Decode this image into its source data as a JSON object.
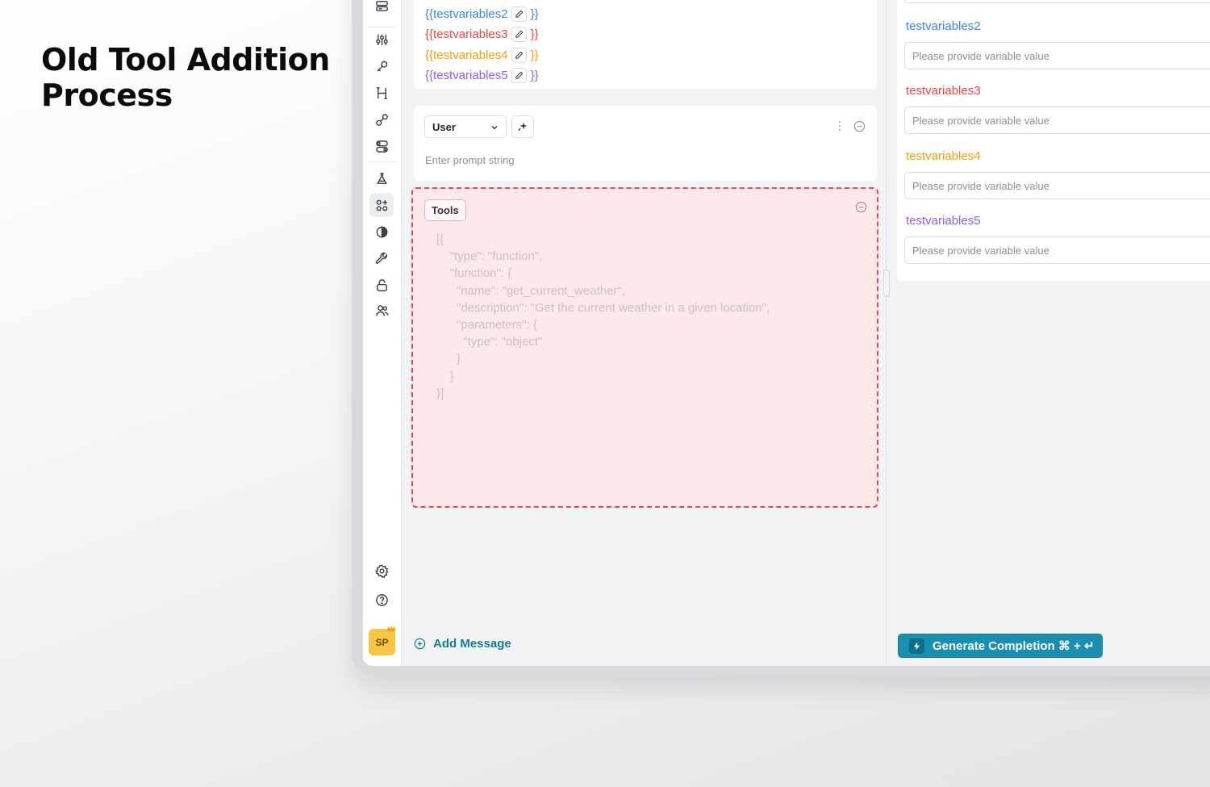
{
  "headline": {
    "line1": "Old Tool Addition",
    "line2": "Process"
  },
  "variables": [
    {
      "open": "{{",
      "name": "testvariables2",
      "close": "}}",
      "color": "#3b82f6"
    },
    {
      "open": "{{",
      "name": "testvariables3",
      "close": "}}",
      "color": "#ef4444"
    },
    {
      "open": "{{",
      "name": "testvariables4",
      "close": "}}",
      "color": "#f59e0b"
    },
    {
      "open": "{{",
      "name": "testvariables5",
      "close": "}}",
      "color": "#8b5cf6"
    }
  ],
  "message": {
    "role": "User",
    "placeholder": "Enter prompt string"
  },
  "tools": {
    "label": "Tools",
    "highlight_color": "#e8474f",
    "code": "[{\n    \"type\": \"function\",\n    \"function\": {\n      \"name\": \"get_current_weather\",\n      \"description\": \"Get the current weather in a given location\",\n      \"parameters\": {\n        \"type\": \"object\"\n      }\n    }\n}]"
  },
  "add_message": "Add Message",
  "right_panel": {
    "variables": [
      {
        "label": "testvariables2",
        "placeholder": "Please provide variable value",
        "color": "#3b82f6"
      },
      {
        "label": "testvariables3",
        "placeholder": "Please provide variable value",
        "color": "#ef4444"
      },
      {
        "label": "testvariables4",
        "placeholder": "Please provide variable value",
        "color": "#f59e0b"
      },
      {
        "label": "testvariables5",
        "placeholder": "Please provide variable value",
        "color": "#8b5cf6"
      }
    ]
  },
  "generate_button": "Generate Completion ⌘ + ↵",
  "user": {
    "initials": "SP"
  },
  "accent_color": "#1a8fb0"
}
